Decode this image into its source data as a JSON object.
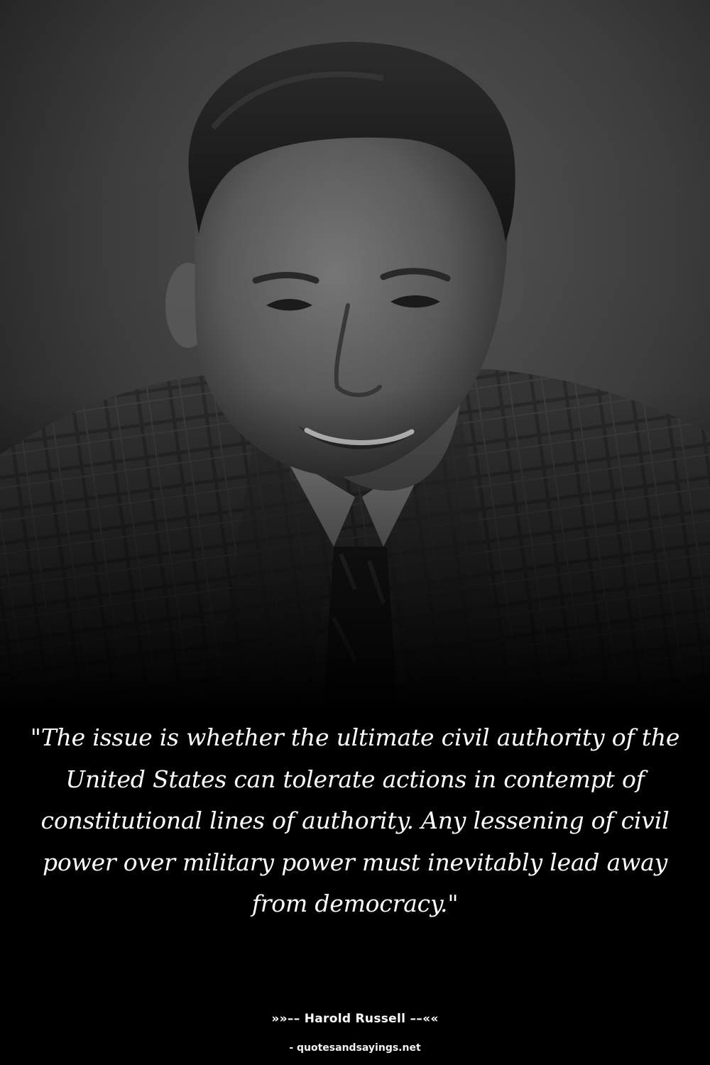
{
  "quote": {
    "text": "\"The issue is whether the ultimate civil authority of the United States can tolerate actions in contempt of constitutional lines of authority. Any lessening of civil power over military power must inevitably lead away from democracy.\""
  },
  "author": {
    "prefix": "»»––",
    "name": "Harold Russell",
    "suffix": "––««"
  },
  "source": {
    "text": "- quotesandsayings.net"
  },
  "colors": {
    "background": "#000000",
    "text": "#ffffff"
  }
}
